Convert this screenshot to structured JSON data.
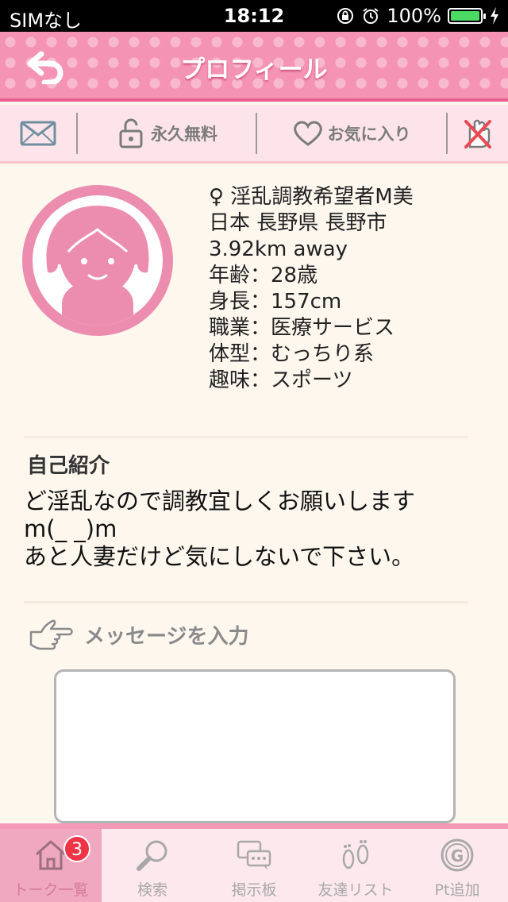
{
  "status_bar": {
    "carrier": "SIMなし",
    "time": "18:12",
    "battery": "100%",
    "battery_level": 1.0
  },
  "header": {
    "title": "プロフィール"
  },
  "actions": {
    "free_label": "永久無料",
    "favorite_label": "お気に入り"
  },
  "profile": {
    "name": "♀ 淫乱調教希望者M美",
    "location": "日本 長野県 長野市",
    "distance": "3.92km away",
    "age": "年齢：28歳",
    "height": "身長：157cm",
    "job": "職業：医療サービス",
    "body": "体型：むっちり系",
    "hobby": "趣味：スポーツ"
  },
  "intro": {
    "heading": "自己紹介",
    "text": " ど淫乱なので調教宜しくお願いします\nm(_ _)m\nあと人妻だけど気にしないで下さい。"
  },
  "message": {
    "label": "メッセージを入力",
    "value": ""
  },
  "tabs": [
    {
      "label": "トーク一覧",
      "badge": "3",
      "active": true
    },
    {
      "label": "検索"
    },
    {
      "label": "掲示板"
    },
    {
      "label": "友達リスト"
    },
    {
      "label": "Pt追加"
    }
  ],
  "colors": {
    "header_pink": "#f593b4",
    "accent_pink": "#e85e8c",
    "badge_red": "#ee3445"
  }
}
